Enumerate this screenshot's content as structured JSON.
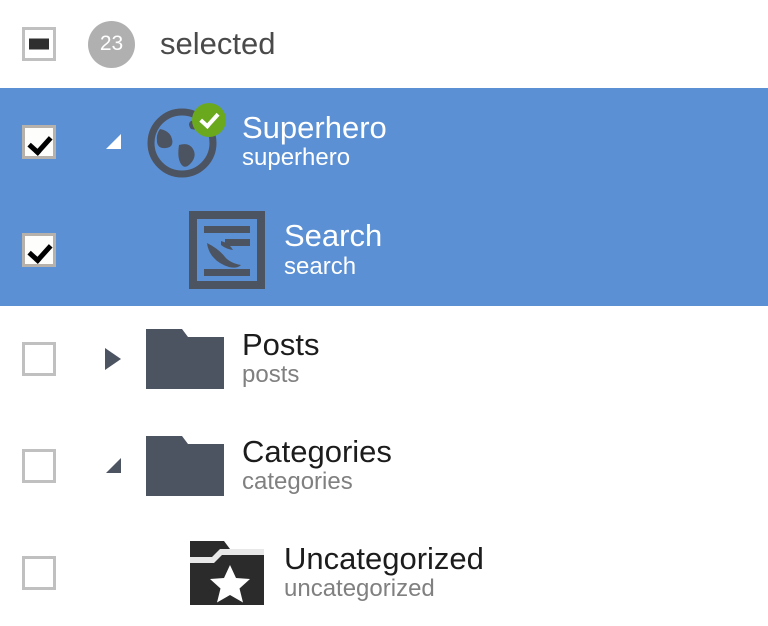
{
  "header": {
    "checkbox_state": "indeterminate",
    "count": "23",
    "label": "selected",
    "badge_color": "#b0b0b0"
  },
  "colors": {
    "selection_blue": "#5b90d4",
    "folder_gray": "#4c5361",
    "badge_green": "#6aa91e",
    "text_primary": "#1c1c1c",
    "text_secondary": "#808080"
  },
  "rows": [
    {
      "title": "Superhero",
      "subtitle": "superhero",
      "icon": "globe-icon",
      "badge": "green-check-badge",
      "checkbox_state": "checked",
      "expander": "expanded",
      "selected": true,
      "indent": 0
    },
    {
      "title": "Search",
      "subtitle": "search",
      "icon": "search-page-icon",
      "badge": "",
      "checkbox_state": "checked",
      "expander": "none",
      "selected": true,
      "indent": 1
    },
    {
      "title": "Posts",
      "subtitle": "posts",
      "icon": "folder-icon",
      "badge": "",
      "checkbox_state": "unchecked",
      "expander": "collapsed",
      "selected": false,
      "indent": 0
    },
    {
      "title": "Categories",
      "subtitle": "categories",
      "icon": "folder-icon",
      "badge": "",
      "checkbox_state": "unchecked",
      "expander": "expanded",
      "selected": false,
      "indent": 0
    },
    {
      "title": "Uncategorized",
      "subtitle": "uncategorized",
      "icon": "folder-star-icon",
      "badge": "",
      "checkbox_state": "unchecked",
      "expander": "none",
      "selected": false,
      "indent": 1
    }
  ]
}
